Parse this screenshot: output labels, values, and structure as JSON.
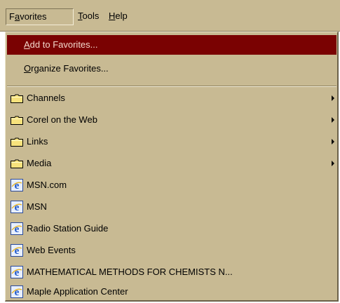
{
  "menubar": {
    "items": [
      {
        "pre": "F",
        "key": "a",
        "post": "vorites"
      },
      {
        "pre": "",
        "key": "T",
        "post": "ools"
      },
      {
        "pre": "",
        "key": "H",
        "post": "elp"
      }
    ]
  },
  "menu": {
    "add": {
      "pre": "",
      "key": "A",
      "post": "dd to Favorites..."
    },
    "organize": {
      "pre": "",
      "key": "O",
      "post": "rganize Favorites..."
    },
    "folders": [
      {
        "label": "Channels",
        "icon": "folder-icon"
      },
      {
        "label": "Corel on the Web",
        "icon": "folder-icon"
      },
      {
        "label": "Links",
        "icon": "folder-icon"
      },
      {
        "label": "Media",
        "icon": "folder-icon"
      }
    ],
    "links": [
      {
        "label": "MSN.com",
        "icon": "internet-explorer-icon"
      },
      {
        "label": "MSN",
        "icon": "internet-explorer-icon"
      },
      {
        "label": "Radio Station Guide",
        "icon": "internet-explorer-icon"
      },
      {
        "label": "Web Events",
        "icon": "internet-explorer-icon"
      },
      {
        "label": "MATHEMATICAL METHODS FOR CHEMISTS N...",
        "icon": "internet-explorer-icon"
      },
      {
        "label": "Maple Application Center",
        "icon": "internet-explorer-icon"
      }
    ]
  },
  "colors": {
    "menu_bg": "#c8ba93",
    "highlight_bg": "#7a0202",
    "highlight_text": "#f3d9cc"
  }
}
